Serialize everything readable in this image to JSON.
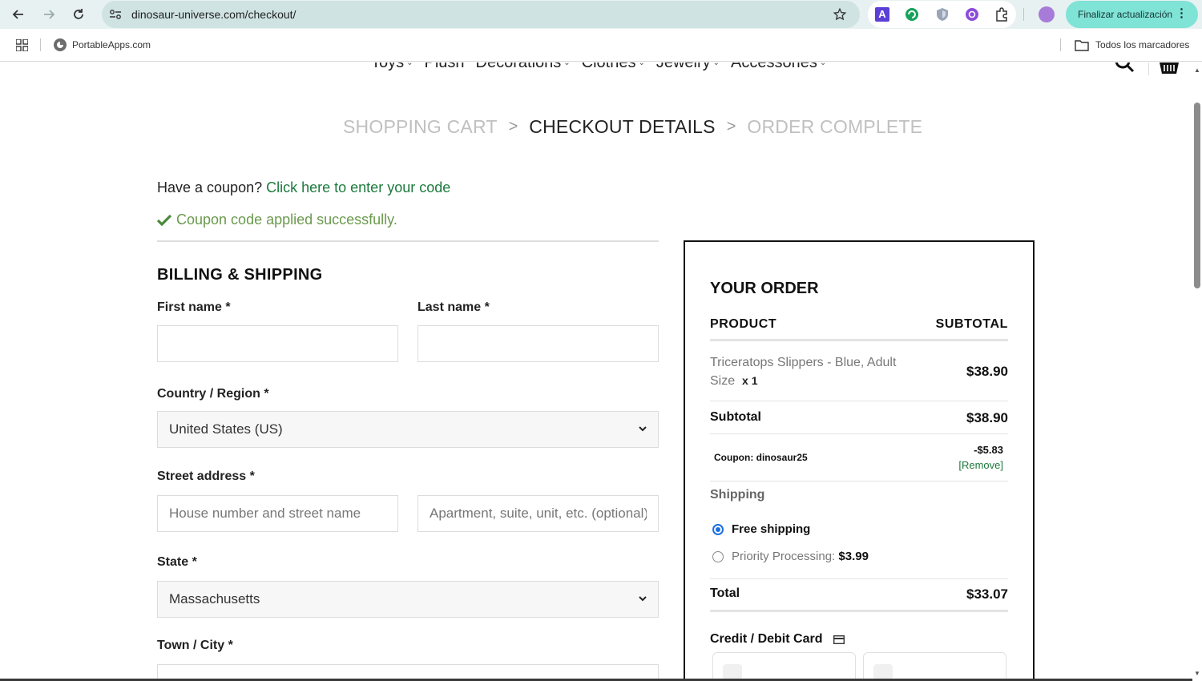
{
  "browser": {
    "url": "dinosaur-universe.com/checkout/",
    "update_button": "Finalizar actualización",
    "bookmark": "PortableApps.com",
    "all_bookmarks": "Todos los marcadores"
  },
  "nav": {
    "items": [
      "Toys",
      "Plush",
      "Decorations",
      "Clothes",
      "Jewelry",
      "Accessories"
    ]
  },
  "steps": {
    "cart": "SHOPPING CART",
    "details": "CHECKOUT DETAILS",
    "complete": "ORDER COMPLETE",
    "separator": ">"
  },
  "coupon": {
    "question": "Have a coupon?",
    "link": "Click here to enter your code",
    "applied": "Coupon code applied successfully."
  },
  "billing": {
    "heading": "BILLING & SHIPPING",
    "first_name_label": "First name *",
    "last_name_label": "Last name *",
    "country_label": "Country / Region *",
    "country_value": "United States (US)",
    "street_label": "Street address *",
    "street_placeholder": "House number and street name",
    "street2_placeholder": "Apartment, suite, unit, etc. (optional)",
    "state_label": "State *",
    "state_value": "Massachusetts",
    "city_label": "Town / City *"
  },
  "order": {
    "title": "YOUR ORDER",
    "col_product": "PRODUCT",
    "col_subtotal": "SUBTOTAL",
    "product_name": "Triceratops Slippers - Blue, Adult Size",
    "product_qty": "x 1",
    "product_price": "$38.90",
    "subtotal_label": "Subtotal",
    "subtotal_value": "$38.90",
    "coupon_label": "Coupon: dinosaur25",
    "coupon_value": "-$5.83",
    "coupon_remove": "[Remove]",
    "shipping_label": "Shipping",
    "shipping_free": "Free shipping",
    "shipping_priority": "Priority Processing:",
    "shipping_priority_price": "$3.99",
    "total_label": "Total",
    "total_value": "$33.07",
    "payment_label": "Credit / Debit Card"
  },
  "colors": {
    "link_green": "#1c7a3c",
    "success_green": "#6a9a4e",
    "radio_blue": "#1a6fe0",
    "update_button_bg": "#7fe3d6"
  }
}
